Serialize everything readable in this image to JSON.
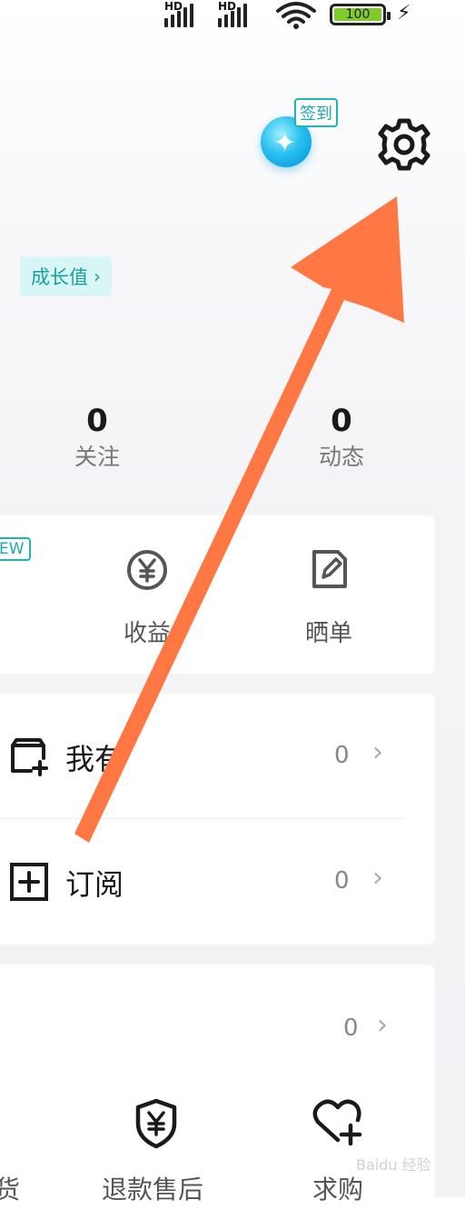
{
  "status_bar": {
    "signal1": "HD",
    "signal2": "HD",
    "battery": "100"
  },
  "header": {
    "sign_in": "签到"
  },
  "profile": {
    "growth": "成长值"
  },
  "stats": [
    {
      "value": "0",
      "label": "关注"
    },
    {
      "value": "0",
      "label": "动态"
    }
  ],
  "tools": {
    "new_badge": "EW",
    "items": [
      {
        "label": "收益"
      },
      {
        "label": "晒单"
      }
    ]
  },
  "list1": [
    {
      "label": "我有",
      "count": "0"
    },
    {
      "label": "订阅",
      "count": "0"
    }
  ],
  "orders": {
    "count": "0",
    "items": [
      {
        "label": "货"
      },
      {
        "label": "退款售后"
      },
      {
        "label": "求购"
      }
    ]
  },
  "watermark": "Baidu 经验",
  "colors": {
    "accent": "#1aa9a6",
    "arrow": "#ff7743",
    "battery": "#7ecb2a"
  }
}
